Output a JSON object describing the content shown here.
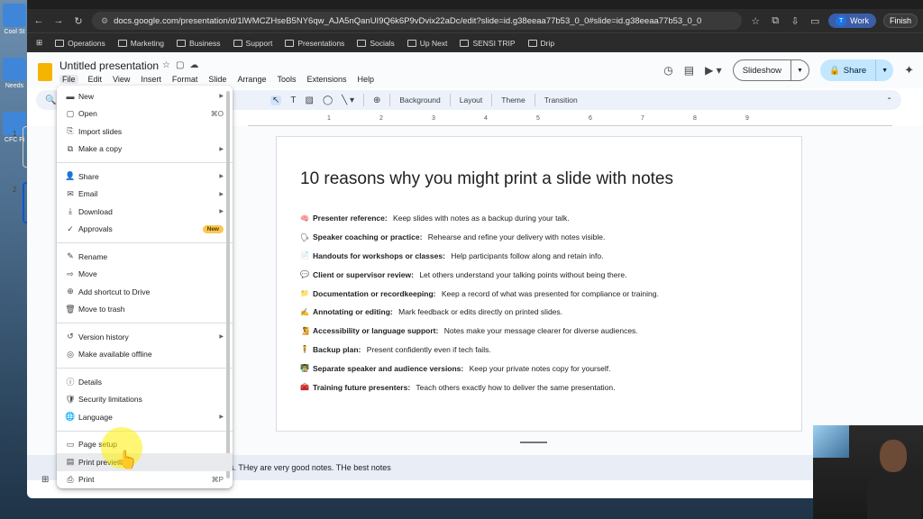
{
  "desktop": {
    "icons": [
      "Cool St",
      "Needs",
      "CFC Fi"
    ]
  },
  "browser": {
    "url": "docs.google.com/presentation/d/1lWMCZHseB5NY6qw_AJA5nQanUI9Q6k6P9vDvix22aDc/edit?slide=id.g38eeaa77b53_0_0#slide=id.g38eeaa77b53_0_0",
    "profile": "Work",
    "profile_initial": "T",
    "finish_label": "Finish",
    "bookmarks": [
      "Operations",
      "Marketing",
      "Business",
      "Support",
      "Presentations",
      "Socials",
      "Up Next",
      "SENSI TRIP",
      "Drip"
    ]
  },
  "header": {
    "title": "Untitled presentation",
    "menus": [
      "File",
      "Edit",
      "View",
      "Insert",
      "Format",
      "Slide",
      "Arrange",
      "Tools",
      "Extensions",
      "Help"
    ],
    "slideshow_label": "Slideshow",
    "share_label": "Share"
  },
  "edit_toolbar": {
    "items": [
      "Background",
      "Layout",
      "Theme",
      "Transition"
    ]
  },
  "ruler": [
    "1",
    "2",
    "3",
    "4",
    "5",
    "6",
    "7",
    "8",
    "9"
  ],
  "filmstrip": [
    "1",
    "2"
  ],
  "slide": {
    "title": "10 reasons why you might print a slide with notes",
    "bullets": [
      {
        "icon": "brain",
        "bold": "Presenter reference:",
        "text": " Keep slides with notes as a backup during your talk."
      },
      {
        "icon": "speaking-head",
        "bold": "Speaker coaching or practice:",
        "text": " Rehearse and refine your delivery with notes visible."
      },
      {
        "icon": "page",
        "bold": "Handouts for workshops or classes:",
        "text": " Help participants follow along and retain info."
      },
      {
        "icon": "speech-bubble",
        "bold": "Client or supervisor review:",
        "text": " Let others understand your talking points without being there."
      },
      {
        "icon": "folder",
        "bold": "Documentation or recordkeeping:",
        "text": " Keep a record of what was presented for compliance or training."
      },
      {
        "icon": "writing-hand",
        "bold": "Annotating or editing:",
        "text": " Mark feedback or edits directly on printed slides."
      },
      {
        "icon": "person",
        "bold": "Accessibility or language support:",
        "text": " Notes make your message clearer for diverse audiences."
      },
      {
        "icon": "person-standing",
        "bold": "Backup plan:",
        "text": " Present confidently even if tech fails."
      },
      {
        "icon": "teacher",
        "bold": "Separate speaker and audience versions:",
        "text": " Keep your private notes copy for yourself."
      },
      {
        "icon": "toolbox",
        "bold": "Training future presenters:",
        "text": " Teach others exactly how to deliver the same presentation."
      }
    ]
  },
  "notes": "s. THey are very good notes. THe best notes",
  "file_menu": {
    "groups": [
      [
        {
          "icon": "slides-icon",
          "label": "New",
          "arrow": true
        },
        {
          "icon": "folder-icon",
          "label": "Open",
          "shortcut": "⌘O"
        },
        {
          "icon": "import-icon",
          "label": "Import slides"
        },
        {
          "icon": "copy-icon",
          "label": "Make a copy",
          "arrow": true
        }
      ],
      [
        {
          "icon": "share-icon",
          "label": "Share",
          "arrow": true
        },
        {
          "icon": "mail-icon",
          "label": "Email",
          "arrow": true
        },
        {
          "icon": "download-icon",
          "label": "Download",
          "arrow": true
        },
        {
          "icon": "approvals-icon",
          "label": "Approvals",
          "badge": "New"
        }
      ],
      [
        {
          "icon": "pencil-icon",
          "label": "Rename"
        },
        {
          "icon": "move-icon",
          "label": "Move"
        },
        {
          "icon": "drive-shortcut-icon",
          "label": "Add shortcut to Drive"
        },
        {
          "icon": "trash-icon",
          "label": "Move to trash"
        }
      ],
      [
        {
          "icon": "history-icon",
          "label": "Version history",
          "arrow": true
        },
        {
          "icon": "offline-icon",
          "label": "Make available offline"
        }
      ],
      [
        {
          "icon": "info-icon",
          "label": "Details"
        },
        {
          "icon": "shield-icon",
          "label": "Security limitations"
        },
        {
          "icon": "globe-icon",
          "label": "Language",
          "arrow": true
        }
      ],
      [
        {
          "icon": "page-setup-icon",
          "label": "Page setup"
        },
        {
          "icon": "print-preview-icon",
          "label": "Print preview",
          "hover": true
        },
        {
          "icon": "printer-icon",
          "label": "Print",
          "shortcut": "⌘P"
        }
      ]
    ]
  }
}
